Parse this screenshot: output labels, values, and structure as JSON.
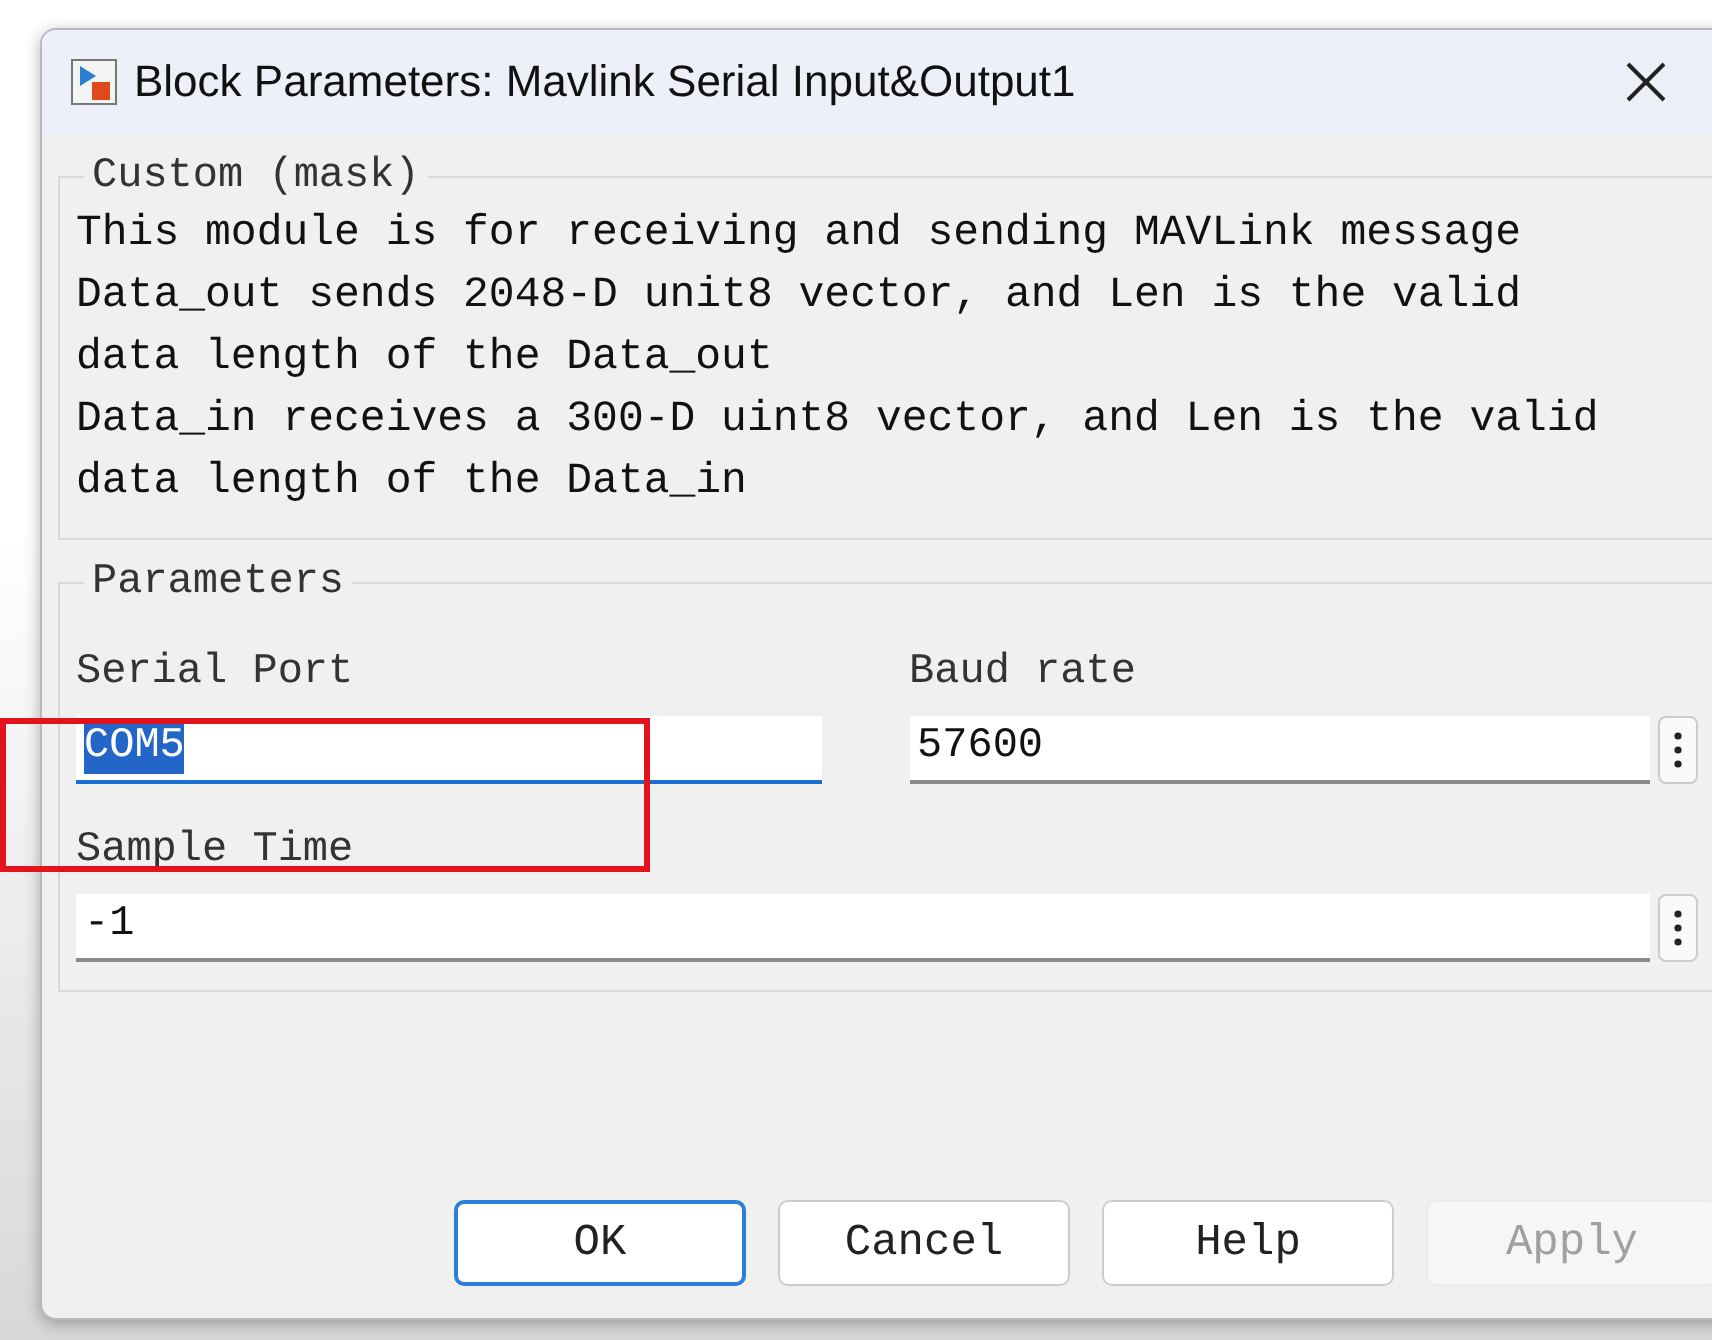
{
  "window": {
    "title": "Block Parameters: Mavlink Serial Input&Output1"
  },
  "description": {
    "heading": "Custom (mask)",
    "lines": [
      "This module is for receiving and sending MAVLink message",
      "Data_out sends 2048-D unit8 vector, and Len is the valid",
      "data length of the Data_out",
      "Data_in receives a 300-D uint8 vector, and Len is the valid",
      "data length of the Data_in"
    ]
  },
  "parameters": {
    "heading": "Parameters",
    "fields": [
      {
        "label": "Serial Port",
        "value": "COM5",
        "focused": true,
        "text_selected": true,
        "has_menu": false
      },
      {
        "label": "Baud rate",
        "value": "57600",
        "focused": false,
        "text_selected": false,
        "has_menu": true
      },
      {
        "label": "Sample Time",
        "value": "-1",
        "focused": false,
        "text_selected": false,
        "has_menu": true
      }
    ]
  },
  "buttons": [
    {
      "label": "OK",
      "default": true,
      "disabled": false
    },
    {
      "label": "Cancel",
      "default": false,
      "disabled": false
    },
    {
      "label": "Help",
      "default": false,
      "disabled": false
    },
    {
      "label": "Apply",
      "default": false,
      "disabled": true
    }
  ],
  "annotations": [
    {
      "kind": "box"
    }
  ]
}
